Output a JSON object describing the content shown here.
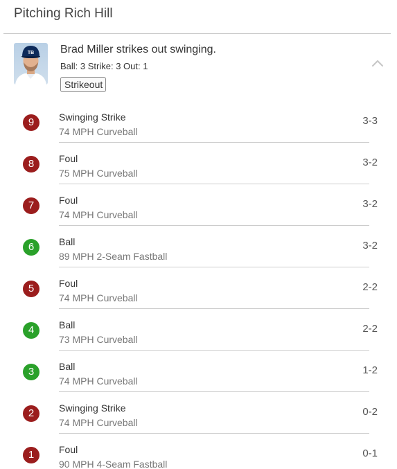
{
  "header": {
    "title": "Pitching Rich Hill"
  },
  "at_bat": {
    "summary": "Brad Miller strikes out swinging.",
    "count_line": "Ball: 3 Strike: 3 Out: 1",
    "result_tag": "Strikeout",
    "avatar_icon": "player-headshot"
  },
  "colors": {
    "strike": "#9b1d1d",
    "ball": "#2aa12a"
  },
  "pitches": [
    {
      "number": "9",
      "result": "Swinging Strike",
      "detail": "74 MPH Curveball",
      "count": "3-3",
      "kind": "strike"
    },
    {
      "number": "8",
      "result": "Foul",
      "detail": "75 MPH Curveball",
      "count": "3-2",
      "kind": "strike"
    },
    {
      "number": "7",
      "result": "Foul",
      "detail": "74 MPH Curveball",
      "count": "3-2",
      "kind": "strike"
    },
    {
      "number": "6",
      "result": "Ball",
      "detail": "89 MPH 2-Seam Fastball",
      "count": "3-2",
      "kind": "ball"
    },
    {
      "number": "5",
      "result": "Foul",
      "detail": "74 MPH Curveball",
      "count": "2-2",
      "kind": "strike"
    },
    {
      "number": "4",
      "result": "Ball",
      "detail": "73 MPH Curveball",
      "count": "2-2",
      "kind": "ball"
    },
    {
      "number": "3",
      "result": "Ball",
      "detail": "74 MPH Curveball",
      "count": "1-2",
      "kind": "ball"
    },
    {
      "number": "2",
      "result": "Swinging Strike",
      "detail": "74 MPH Curveball",
      "count": "0-2",
      "kind": "strike"
    },
    {
      "number": "1",
      "result": "Foul",
      "detail": "90 MPH 4-Seam Fastball",
      "count": "0-1",
      "kind": "strike"
    }
  ]
}
